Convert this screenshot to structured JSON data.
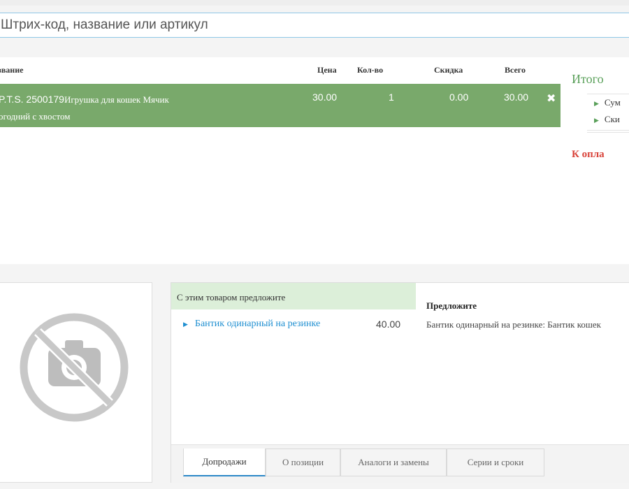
{
  "search": {
    "placeholder": "Штрих-код, название или артикул"
  },
  "cart": {
    "columns": {
      "name": "звание",
      "price": "Цена",
      "qty": "Кол-во",
      "discount": "Скидка",
      "total": "Всего"
    },
    "rows": [
      {
        "name_line1_sku": "P.T.S. 2500179",
        "name_line1_text": "Игрушка для кошек Мячик",
        "name_line2": "огодний с хвостом",
        "price": "30.00",
        "qty": "1",
        "discount": "0.00",
        "total": "30.00",
        "remove_icon": "close-icon"
      }
    ]
  },
  "summary": {
    "title": "Итого",
    "items": [
      {
        "label": "Сум"
      },
      {
        "label": "Ски"
      }
    ],
    "pay_label": "К опла"
  },
  "product_image": {
    "icon": "no-camera-icon"
  },
  "recommendations": {
    "header": "С этим товаром предложите",
    "items": [
      {
        "name": "Бантик одинарный на резинке",
        "price": "40.00"
      }
    ],
    "suggest_title": "Предложите",
    "suggest_text": "Бантик одинарный на резинке: Бантик кошек"
  },
  "tabs": [
    {
      "label": "Допродажи",
      "active": true
    },
    {
      "label": "О позиции"
    },
    {
      "label": "Аналоги и замены"
    },
    {
      "label": "Серии и сроки"
    }
  ],
  "colors": {
    "row_highlight": "#79a96b",
    "accent_green": "#5aa05a",
    "pay_red": "#d9443b",
    "link_blue": "#1f8fd1",
    "tab_active_border": "#2b87c7"
  }
}
